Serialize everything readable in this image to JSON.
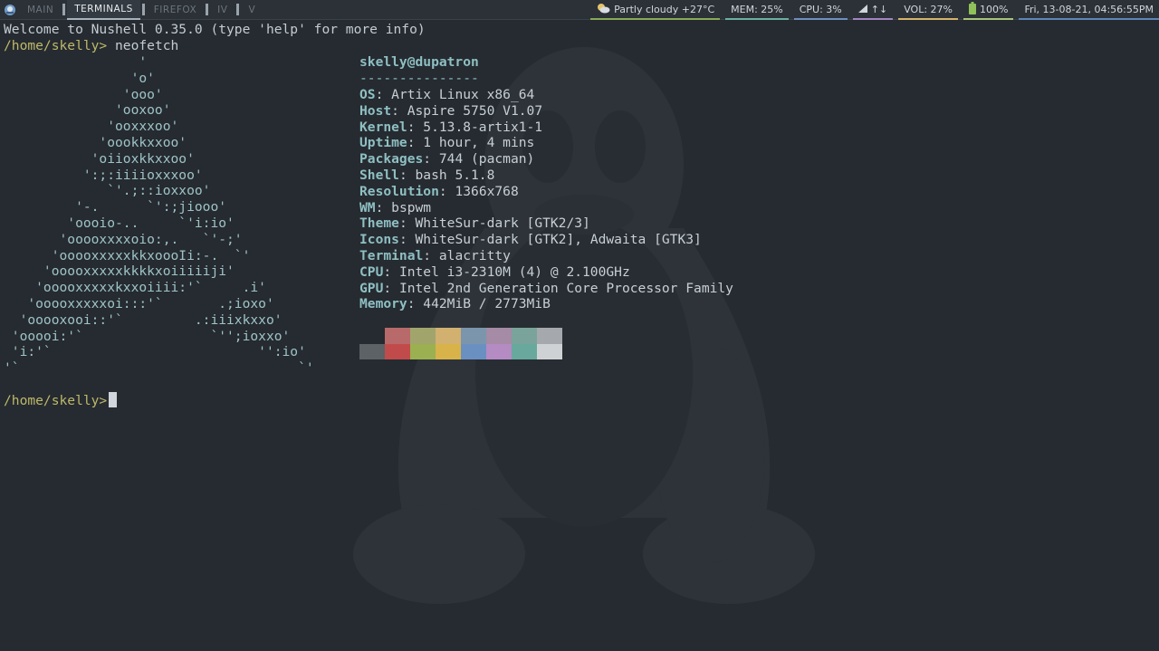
{
  "topbar": {
    "workspaces": [
      {
        "label": "MAIN",
        "active": false
      },
      {
        "label": "TERMINALS",
        "active": true
      },
      {
        "label": "FIREFOX",
        "active": false
      },
      {
        "label": "IV",
        "active": false
      },
      {
        "label": "V",
        "active": false
      }
    ],
    "weather": "Partly cloudy +27°C",
    "weather_icon": "partly-cloudy-icon",
    "mem": "MEM: 25%",
    "cpu": "CPU: 3%",
    "net": "↑↓",
    "net_icon": "signal-icon",
    "vol": "VOL: 27%",
    "battery": "100%",
    "battery_icon": "battery-icon",
    "datetime": "Fri, 13-08-21, 04:56:55PM"
  },
  "terminal": {
    "welcome": "Welcome to Nushell 0.35.0 (type 'help' for more info)",
    "prompt1": "/home/skelly>",
    "command1": " neofetch",
    "ascii": [
      "                 '",
      "                'o'",
      "               'ooo'",
      "              'ooxoo'",
      "             'ooxxxoo'",
      "            'oookkxxoo'",
      "           'oiioxkkxxoo'",
      "          ':;:iiiioxxxoo'",
      "             `'.;::ioxxoo'",
      "         '-.      `':;jiooo'",
      "        'oooio-..     `'i:io'",
      "       'ooooxxxxoio:,.   `'-;'",
      "      'ooooxxxxxkkxoooIi:-.  `'",
      "     'ooooxxxxxkkkkxoiiiiiji'",
      "    'ooooxxxxxkxxoiiii:'`     .i'",
      "   'ooooxxxxxoi:::'`       .;ioxo'",
      "  'ooooxooi::'`         .:iiixkxxo'",
      " 'ooooi:'`                `'';ioxxo'",
      " 'i:'`                          '':io'",
      "'`                                   `'"
    ],
    "header": "skelly@dupatron",
    "separator": "---------------",
    "info": [
      {
        "key": "OS",
        "value": " Artix Linux x86_64"
      },
      {
        "key": "Host",
        "value": " Aspire 5750 V1.07"
      },
      {
        "key": "Kernel",
        "value": " 5.13.8-artix1-1"
      },
      {
        "key": "Uptime",
        "value": " 1 hour, 4 mins"
      },
      {
        "key": "Packages",
        "value": " 744 (pacman)"
      },
      {
        "key": "Shell",
        "value": " bash 5.1.8"
      },
      {
        "key": "Resolution",
        "value": " 1366x768"
      },
      {
        "key": "WM",
        "value": " bspwm"
      },
      {
        "key": "Theme",
        "value": " WhiteSur-dark [GTK2/3]"
      },
      {
        "key": "Icons",
        "value": " WhiteSur-dark [GTK2], Adwaita [GTK3]"
      },
      {
        "key": "Terminal",
        "value": " alacritty"
      },
      {
        "key": "CPU",
        "value": " Intel i3-2310M (4) @ 2.100GHz"
      },
      {
        "key": "GPU",
        "value": " Intel 2nd Generation Core Processor Family"
      },
      {
        "key": "Memory",
        "value": " 442MiB / 2773MiB"
      }
    ],
    "colors_row1": [
      "#252b30",
      "#b86a6a",
      "#a1a56c",
      "#d1b070",
      "#7b95ad",
      "#a58ba5",
      "#7aa39c",
      "#a5a9ad"
    ],
    "colors_row2": [
      "#5c6266",
      "#c14b4b",
      "#9bb050",
      "#d8b34a",
      "#6a90c2",
      "#b48bc2",
      "#68a89d",
      "#cfd2d4"
    ],
    "prompt2": "/home/skelly>"
  }
}
